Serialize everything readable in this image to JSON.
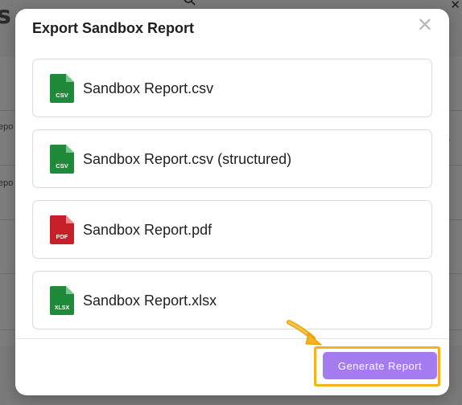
{
  "background": {
    "heading_fragment": "s",
    "row_text_1": "epo",
    "row_text_2": "epo",
    "close_glyph": "✕",
    "chevron_glyph": "⌄"
  },
  "modal": {
    "title": "Export Sandbox Report",
    "close_glyph": "✕",
    "files": [
      {
        "name": "Sandbox Report.csv",
        "badge": "CSV",
        "color": "#1e8a3a"
      },
      {
        "name": "Sandbox Report.csv (structured)",
        "badge": "CSV",
        "color": "#1e8a3a"
      },
      {
        "name": "Sandbox Report.pdf",
        "badge": "PDF",
        "color": "#c8202a"
      },
      {
        "name": "Sandbox Report.xlsx",
        "badge": "XLSX",
        "color": "#1e8a3a"
      }
    ],
    "generate_label": "Generate Report"
  },
  "colors": {
    "accent": "#a47cf0",
    "highlight": "#f5b21a"
  }
}
